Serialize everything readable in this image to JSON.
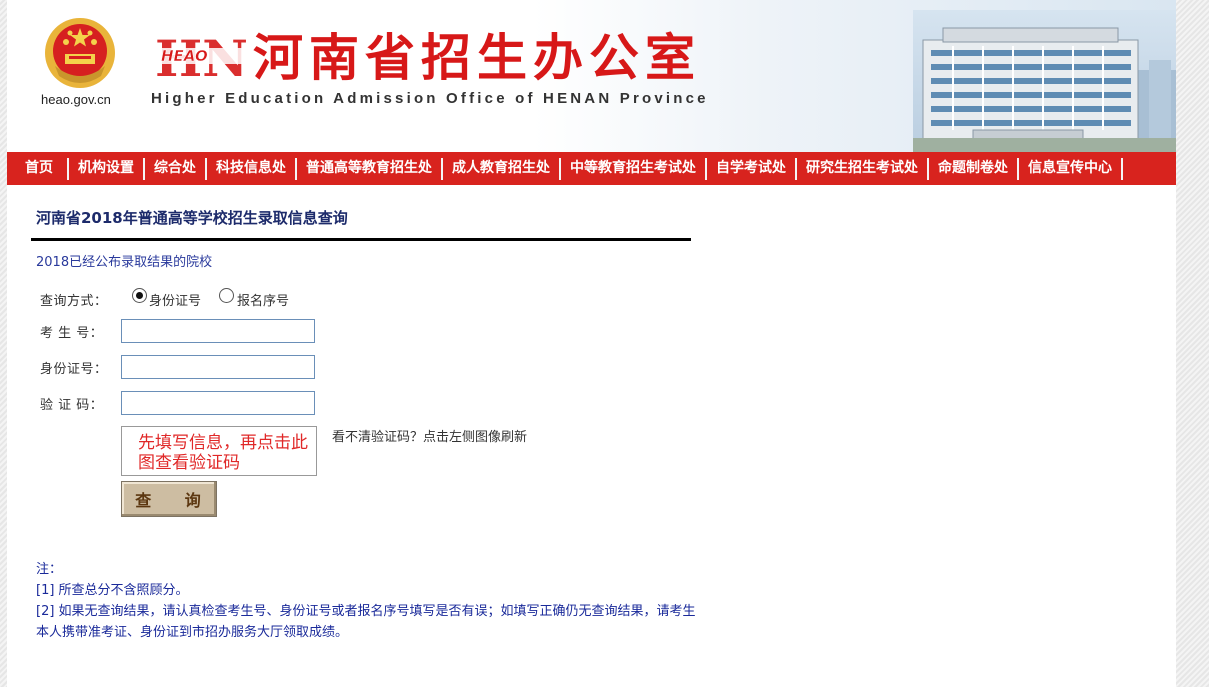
{
  "header": {
    "domain": "heao.gov.cn",
    "logo_text": "HEAO",
    "title": "河南省招生办公室",
    "subtitle": "Higher Education Admission Office of HENAN Province"
  },
  "nav": {
    "items": [
      "首页",
      "机构设置",
      "综合处",
      "科技信息处",
      "普通高等教育招生处",
      "成人教育招生处",
      "中等教育招生考试处",
      "自学考试处",
      "研究生招生考试处",
      "命题制卷处",
      "信息宣传中心"
    ]
  },
  "main": {
    "title": "河南省2018年普通高等学校招生录取信息查询",
    "published_link": "2018已经公布录取结果的院校",
    "form": {
      "mode_label": "查询方式：",
      "mode_options": [
        "身份证号",
        "报名序号"
      ],
      "mode_selected": "身份证号",
      "exam_no_label": "考 生 号：",
      "id_no_label": "身份证号：",
      "captcha_label": "验 证 码：",
      "captcha_image_text": "先填写信息，再点击此图查看验证码",
      "captcha_hint": "看不清验证码？点击左侧图像刷新",
      "submit_label": "查 询"
    },
    "notes": {
      "heading": "注：",
      "items": [
        "[1] 所查总分不含照顾分。",
        "[2] 如果无查询结果，请认真检查考生号、身份证号或者报名序号填写是否有误；如填写正确仍无查询结果，请考生本人携带准考证、身份证到市招办服务大厅领取成绩。"
      ]
    }
  },
  "colors": {
    "nav_bg": "#d8231e",
    "title_red": "#d71818",
    "note_blue": "#1a2a9a"
  }
}
